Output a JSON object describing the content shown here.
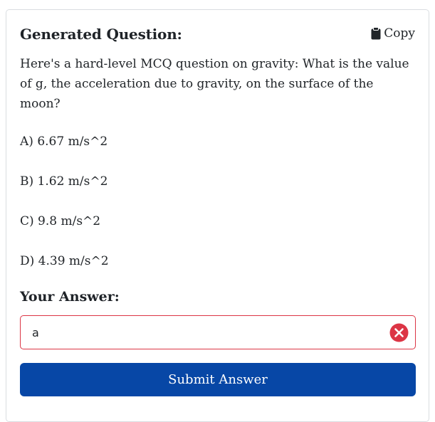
{
  "header": {
    "title": "Generated Question:",
    "copy_label": "Copy",
    "copy_icon": "clipboard-icon"
  },
  "question": {
    "text": "Here's a hard-level MCQ question on gravity: What is the value of g, the acceleration due to gravity, on the surface of the moon?"
  },
  "options": [
    {
      "label": "A) 6.67 m/s^2"
    },
    {
      "label": "B) 1.62 m/s^2"
    },
    {
      "label": "C) 9.8 m/s^2"
    },
    {
      "label": "D) 4.39 m/s^2"
    }
  ],
  "answer": {
    "label": "Your Answer:",
    "value": "a",
    "validation_state": "invalid",
    "status_icon": "error-x-icon"
  },
  "submit": {
    "label": "Submit Answer"
  },
  "colors": {
    "primary": "#0747a6",
    "error": "#dc3545",
    "border": "#dadde1",
    "text": "#212529"
  }
}
